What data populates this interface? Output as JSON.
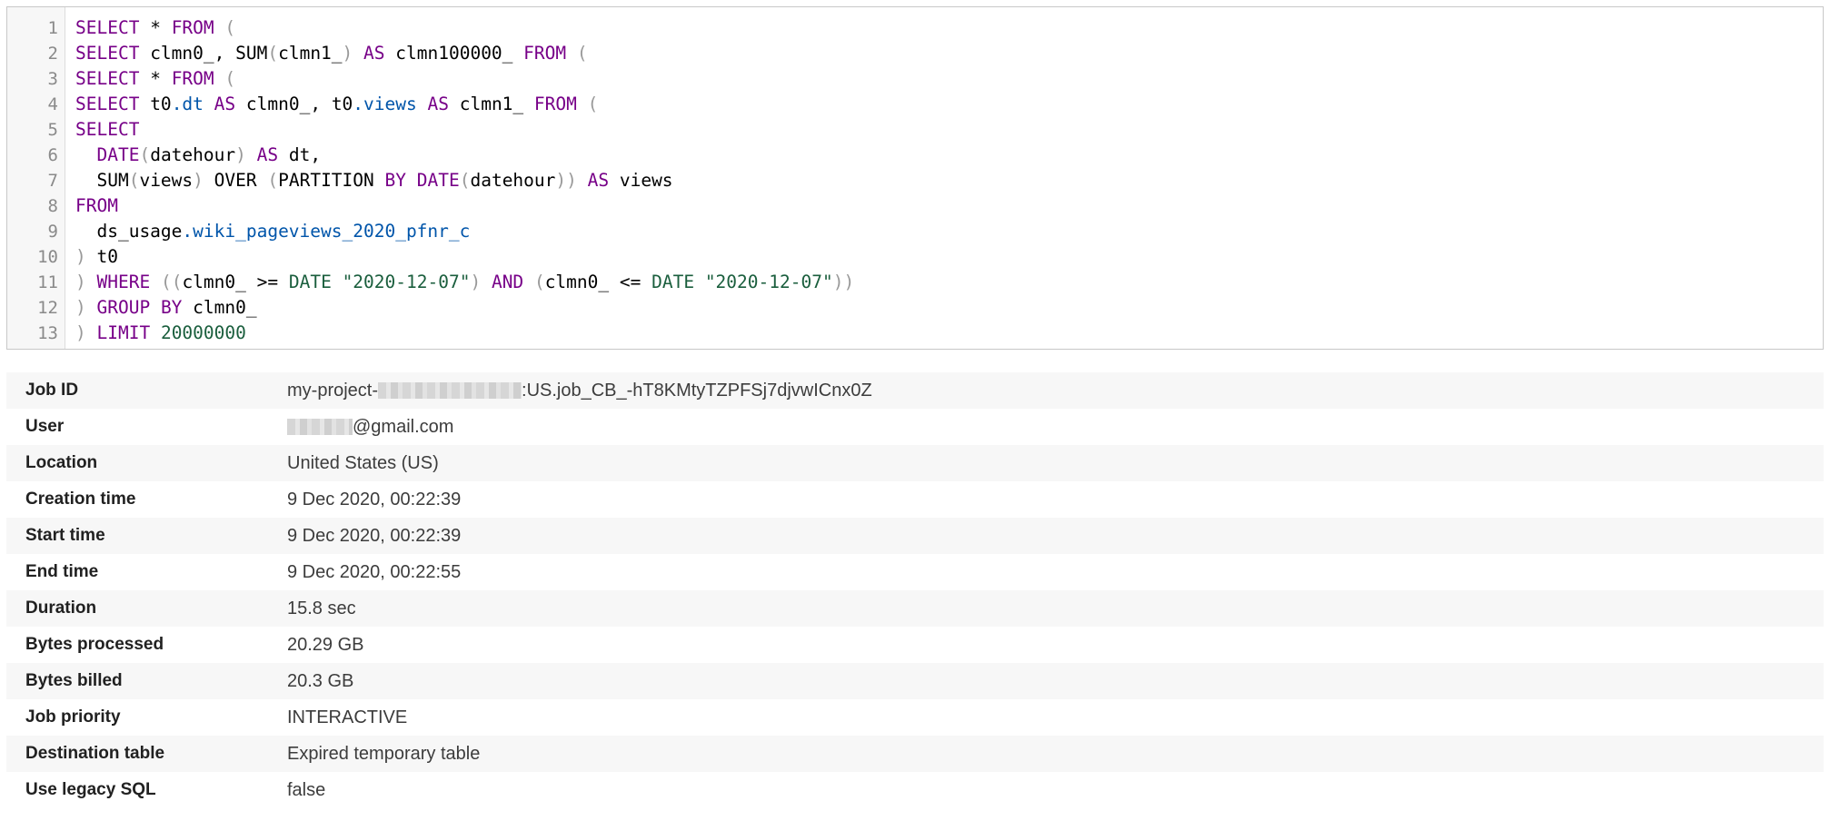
{
  "query_editor": {
    "lines": [
      {
        "num": "1",
        "tokens": [
          {
            "t": "SELECT",
            "c": "kw"
          },
          {
            "t": " * ",
            "c": "plain"
          },
          {
            "t": "FROM",
            "c": "kw"
          },
          {
            "t": " ",
            "c": "plain"
          },
          {
            "t": "(",
            "c": "punc"
          }
        ]
      },
      {
        "num": "2",
        "tokens": [
          {
            "t": "SELECT",
            "c": "kw"
          },
          {
            "t": " clmn0_, SUM",
            "c": "plain"
          },
          {
            "t": "(",
            "c": "punc"
          },
          {
            "t": "clmn1_",
            "c": "plain"
          },
          {
            "t": ")",
            "c": "punc"
          },
          {
            "t": " ",
            "c": "plain"
          },
          {
            "t": "AS",
            "c": "kw"
          },
          {
            "t": " clmn100000_ ",
            "c": "plain"
          },
          {
            "t": "FROM",
            "c": "kw"
          },
          {
            "t": " ",
            "c": "plain"
          },
          {
            "t": "(",
            "c": "punc"
          }
        ]
      },
      {
        "num": "3",
        "tokens": [
          {
            "t": "SELECT",
            "c": "kw"
          },
          {
            "t": " * ",
            "c": "plain"
          },
          {
            "t": "FROM",
            "c": "kw"
          },
          {
            "t": " ",
            "c": "plain"
          },
          {
            "t": "(",
            "c": "punc"
          }
        ]
      },
      {
        "num": "4",
        "tokens": [
          {
            "t": "SELECT",
            "c": "kw"
          },
          {
            "t": " t0",
            "c": "plain"
          },
          {
            "t": ".dt",
            "c": "prop"
          },
          {
            "t": " ",
            "c": "plain"
          },
          {
            "t": "AS",
            "c": "kw"
          },
          {
            "t": " clmn0_, t0",
            "c": "plain"
          },
          {
            "t": ".views",
            "c": "prop"
          },
          {
            "t": " ",
            "c": "plain"
          },
          {
            "t": "AS",
            "c": "kw"
          },
          {
            "t": " clmn1_ ",
            "c": "plain"
          },
          {
            "t": "FROM",
            "c": "kw"
          },
          {
            "t": " ",
            "c": "plain"
          },
          {
            "t": "(",
            "c": "punc"
          }
        ]
      },
      {
        "num": "5",
        "tokens": [
          {
            "t": "SELECT",
            "c": "kw"
          }
        ]
      },
      {
        "num": "6",
        "tokens": [
          {
            "t": "  ",
            "c": "plain"
          },
          {
            "t": "DATE",
            "c": "kw"
          },
          {
            "t": "(",
            "c": "punc"
          },
          {
            "t": "datehour",
            "c": "plain"
          },
          {
            "t": ")",
            "c": "punc"
          },
          {
            "t": " ",
            "c": "plain"
          },
          {
            "t": "AS",
            "c": "kw"
          },
          {
            "t": " dt,",
            "c": "plain"
          }
        ]
      },
      {
        "num": "7",
        "tokens": [
          {
            "t": "  SUM",
            "c": "plain"
          },
          {
            "t": "(",
            "c": "punc"
          },
          {
            "t": "views",
            "c": "plain"
          },
          {
            "t": ")",
            "c": "punc"
          },
          {
            "t": " OVER ",
            "c": "plain"
          },
          {
            "t": "(",
            "c": "punc"
          },
          {
            "t": "PARTITION ",
            "c": "plain"
          },
          {
            "t": "BY",
            "c": "kw"
          },
          {
            "t": " ",
            "c": "plain"
          },
          {
            "t": "DATE",
            "c": "kw"
          },
          {
            "t": "(",
            "c": "punc"
          },
          {
            "t": "datehour",
            "c": "plain"
          },
          {
            "t": "))",
            "c": "punc"
          },
          {
            "t": " ",
            "c": "plain"
          },
          {
            "t": "AS",
            "c": "kw"
          },
          {
            "t": " views",
            "c": "plain"
          }
        ]
      },
      {
        "num": "8",
        "tokens": [
          {
            "t": "FROM",
            "c": "kw"
          }
        ]
      },
      {
        "num": "9",
        "tokens": [
          {
            "t": "  ds_usage",
            "c": "plain"
          },
          {
            "t": ".wiki_pageviews_2020_pfnr_c",
            "c": "prop"
          }
        ]
      },
      {
        "num": "10",
        "tokens": [
          {
            "t": ")",
            "c": "punc"
          },
          {
            "t": " t0",
            "c": "plain"
          }
        ]
      },
      {
        "num": "11",
        "tokens": [
          {
            "t": ")",
            "c": "punc"
          },
          {
            "t": " ",
            "c": "plain"
          },
          {
            "t": "WHERE",
            "c": "kw"
          },
          {
            "t": " ",
            "c": "plain"
          },
          {
            "t": "((",
            "c": "punc"
          },
          {
            "t": "clmn0_ >= ",
            "c": "plain"
          },
          {
            "t": "DATE",
            "c": "str"
          },
          {
            "t": " ",
            "c": "plain"
          },
          {
            "t": "\"2020-12-07\"",
            "c": "str"
          },
          {
            "t": ")",
            "c": "punc"
          },
          {
            "t": " ",
            "c": "plain"
          },
          {
            "t": "AND",
            "c": "kw"
          },
          {
            "t": " ",
            "c": "plain"
          },
          {
            "t": "(",
            "c": "punc"
          },
          {
            "t": "clmn0_ <= ",
            "c": "plain"
          },
          {
            "t": "DATE",
            "c": "str"
          },
          {
            "t": " ",
            "c": "plain"
          },
          {
            "t": "\"2020-12-07\"",
            "c": "str"
          },
          {
            "t": "))",
            "c": "punc"
          }
        ]
      },
      {
        "num": "12",
        "tokens": [
          {
            "t": ")",
            "c": "punc"
          },
          {
            "t": " ",
            "c": "plain"
          },
          {
            "t": "GROUP BY",
            "c": "kw"
          },
          {
            "t": " clmn0_",
            "c": "plain"
          }
        ]
      },
      {
        "num": "13",
        "tokens": [
          {
            "t": ")",
            "c": "punc"
          },
          {
            "t": " ",
            "c": "plain"
          },
          {
            "t": "LIMIT",
            "c": "kw"
          },
          {
            "t": " ",
            "c": "plain"
          },
          {
            "t": "20000000",
            "c": "num"
          }
        ]
      }
    ]
  },
  "job_details": {
    "job_id": {
      "label": "Job ID",
      "prefix": "my-project-",
      "suffix": ":US.job_CB_-hT8KMtyTZPFSj7djvwICnx0Z"
    },
    "user": {
      "label": "User",
      "suffix": "@gmail.com"
    },
    "location": {
      "label": "Location",
      "value": "United States (US)"
    },
    "creation_time": {
      "label": "Creation time",
      "value": "9 Dec 2020, 00:22:39"
    },
    "start_time": {
      "label": "Start time",
      "value": "9 Dec 2020, 00:22:39"
    },
    "end_time": {
      "label": "End time",
      "value": "9 Dec 2020, 00:22:55"
    },
    "duration": {
      "label": "Duration",
      "value": "15.8 sec"
    },
    "bytes_processed": {
      "label": "Bytes processed",
      "value": "20.29 GB"
    },
    "bytes_billed": {
      "label": "Bytes billed",
      "value": "20.3 GB"
    },
    "job_priority": {
      "label": "Job priority",
      "value": "INTERACTIVE"
    },
    "destination_table": {
      "label": "Destination table",
      "value": "Expired temporary table"
    },
    "use_legacy_sql": {
      "label": "Use legacy SQL",
      "value": "false"
    }
  }
}
